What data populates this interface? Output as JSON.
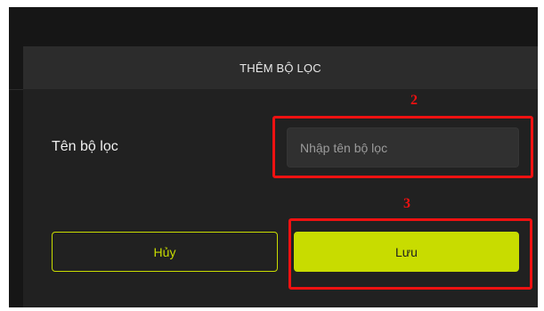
{
  "dialog": {
    "title": "THÊM BỘ LỌC",
    "field_label": "Tên bộ lọc",
    "name_input": {
      "placeholder": "Nhập tên bộ lọc"
    },
    "cancel_label": "Hủy",
    "save_label": "Lưu"
  },
  "annotations": [
    {
      "label": "2"
    },
    {
      "label": "3"
    }
  ],
  "colors": {
    "accent": "#c8dc00",
    "accent_text": "#1e1e1e",
    "annotation": "#ee1111",
    "backdrop": "#161616",
    "dialog_header": "#2c2c2c",
    "dialog_body": "#212121",
    "input_bg": "#303030"
  }
}
